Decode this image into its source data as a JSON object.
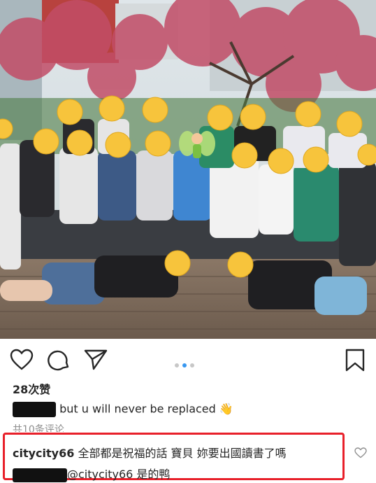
{
  "post": {
    "photo_alt": "group photo under blossoming tree",
    "carousel": {
      "total": 3,
      "active_index": 1
    },
    "likes_label": "28次赞",
    "comments": [
      {
        "user": "",
        "text": "but u will never be replaced",
        "emoji": "👋",
        "user_redacted": true
      },
      {
        "user": "citycity66",
        "text": "全部都是祝福的話 寶貝 妳要出國讀書了嗎",
        "user_redacted": false
      },
      {
        "user": "",
        "mention": "@citycity66",
        "text": "是的鸭",
        "user_redacted": true
      }
    ],
    "view_all_label": "共10条评论"
  },
  "icons": {
    "like": "heart-icon",
    "comment": "comment-bubble-icon",
    "share": "paper-plane-icon",
    "save": "bookmark-icon",
    "comment_like": "small-heart-icon"
  },
  "colors": {
    "highlight": "#e8202a",
    "active_dot": "#3897f0"
  }
}
